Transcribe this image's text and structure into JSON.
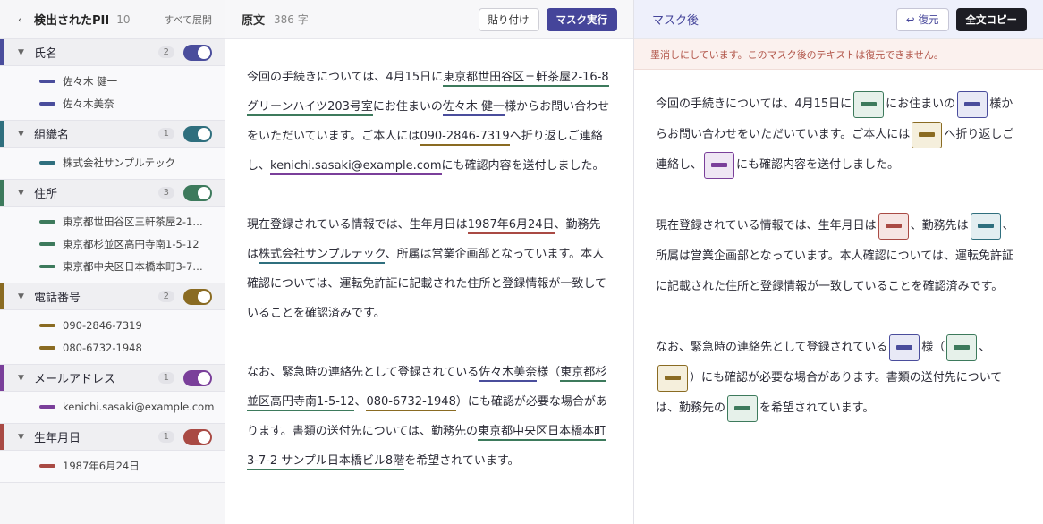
{
  "colors": {
    "name": "#4a4d9c",
    "org": "#2f6f7e",
    "address": "#3d7a5c",
    "phone": "#8a6b22",
    "email": "#7a3f9a",
    "dob": "#a94a44"
  },
  "sidebar": {
    "back_icon": "chevron-left-icon",
    "title": "検出されたPII",
    "count": "10",
    "expand_all": "すべて展開",
    "groups": [
      {
        "name": "氏名",
        "count": "2",
        "items": [
          "佐々木 健一",
          "佐々木美奈"
        ]
      },
      {
        "name": "組織名",
        "count": "1",
        "items": [
          "株式会社サンプルテック"
        ]
      },
      {
        "name": "住所",
        "count": "3",
        "items": [
          "東京都世田谷区三軒茶屋2-1…",
          "東京都杉並区高円寺南1-5-12",
          "東京都中央区日本橋本町3-7…"
        ]
      },
      {
        "name": "電話番号",
        "count": "2",
        "items": [
          "090-2846-7319",
          "080-6732-1948"
        ]
      },
      {
        "name": "メールアドレス",
        "count": "1",
        "items": [
          "kenichi.sasaki@example.com"
        ]
      },
      {
        "name": "生年月日",
        "count": "1",
        "items": [
          "1987年6月24日"
        ]
      }
    ]
  },
  "original": {
    "title": "原文",
    "char_count": "386 字",
    "paste_label": "貼り付け",
    "mask_label": "マスク実行",
    "p1": {
      "t1": "今回の手続きについては、4月15日に",
      "addr1": "東京都世田谷区三軒茶屋2-16-8 グリーンハイツ203号室",
      "t2": "にお住まいの",
      "name1": "佐々木 健一",
      "t3": "様からお問い合わせをいただいています。ご本人には",
      "phone1": "090-2846-7319",
      "t4": "へ折り返しご連絡し、",
      "email1": "kenichi.sasaki@example.com",
      "t5": "にも確認内容を送付しました。"
    },
    "p2": {
      "t1": "現在登録されている情報では、生年月日は",
      "dob": "1987年6月24日",
      "t2": "、勤務先は",
      "org": "株式会社サンプルテック",
      "t3": "、所属は営業企画部となっています。本人確認については、運転免許証に記載された住所と登録情報が一致していることを確認済みです。"
    },
    "p3": {
      "t1": "なお、緊急時の連絡先として登録されている",
      "name2": "佐々木美奈",
      "t2": "様（",
      "addr2": "東京都杉並区高円寺南1-5-12",
      "t3": "、",
      "phone2": "080-6732-1948",
      "t4": "）にも確認が必要な場合があります。書類の送付先については、勤務先の",
      "addr3": "東京都中央区日本橋本町3-7-2 サンプル日本橋ビル8階",
      "t5": "を希望されています。"
    }
  },
  "masked": {
    "title": "マスク後",
    "restore_label": "復元",
    "restore_icon": "undo-icon",
    "copy_label": "全文コピー",
    "warning": "墨消しにしています。このマスク後のテキストは復元できません。",
    "p1": {
      "t1": "今回の手続きについては、4月15日に",
      "t2": "にお住まいの",
      "t3": "様からお問い合わせをいただいています。ご本人には",
      "t4": "へ折り返しご連絡し、",
      "t5": "にも確認内容を送付しました。"
    },
    "p2": {
      "t1": "現在登録されている情報では、生年月日は",
      "t2": "、勤務先は",
      "t3": "、所属は営業企画部となっています。本人確認については、運転免許証に記載された住所と登録情報が一致していることを確認済みです。"
    },
    "p3": {
      "t1": "なお、緊急時の連絡先として登録されている",
      "t2": "様（",
      "t3": "、",
      "t4": "）にも確認が必要な場合があります。書類の送付先については、勤務先の",
      "t5": "を希望されています。"
    }
  }
}
